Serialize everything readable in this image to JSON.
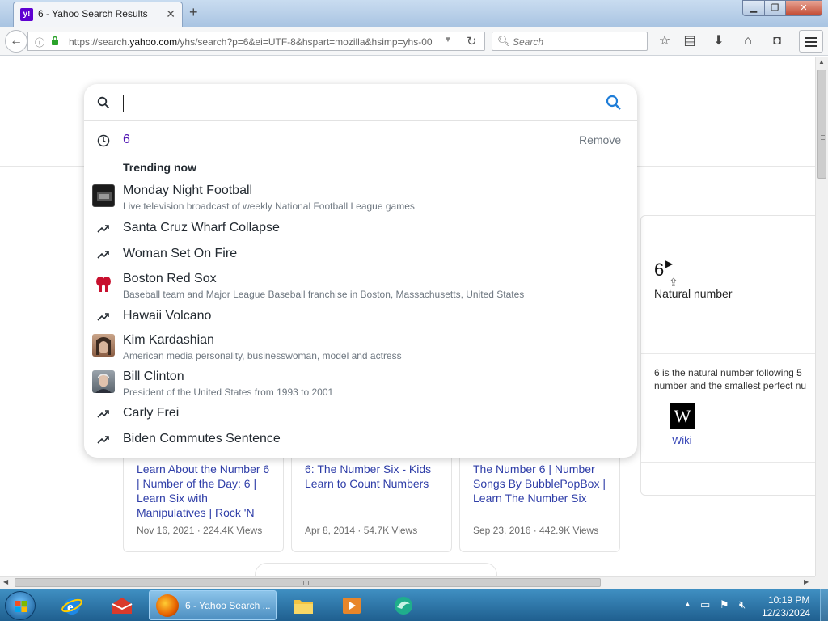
{
  "browser": {
    "tab_title": "6 - Yahoo Search Results",
    "tab_favicon": "y!",
    "url_prefix": "https://search.",
    "url_domain": "yahoo.com",
    "url_rest": "/yhs/search?p=6&ei=UTF-8&hspart=mozilla&hsimp=yhs-00",
    "search_placeholder": "Search",
    "icons": [
      "back-icon",
      "info-icon",
      "lock-icon",
      "reload-icon",
      "search-icon",
      "bookmark-star-icon",
      "reading-list-icon",
      "download-icon",
      "home-icon",
      "pocket-icon",
      "hamburger-menu-icon"
    ]
  },
  "search_dropdown": {
    "history": {
      "query": "6",
      "remove_label": "Remove"
    },
    "trending_header": "Trending now",
    "items": [
      {
        "title": "Monday Night Football",
        "subtitle": "Live television broadcast of weekly National Football League games",
        "kind": "thumb"
      },
      {
        "title": "Santa Cruz Wharf Collapse",
        "subtitle": "",
        "kind": "trend"
      },
      {
        "title": "Woman Set On Fire",
        "subtitle": "",
        "kind": "trend"
      },
      {
        "title": "Boston Red Sox",
        "subtitle": "Baseball team and Major League Baseball franchise in Boston, Massachusetts, United States",
        "kind": "thumb"
      },
      {
        "title": "Hawaii Volcano",
        "subtitle": "",
        "kind": "trend"
      },
      {
        "title": "Kim Kardashian",
        "subtitle": "American media personality, businesswoman, model and actress",
        "kind": "thumb"
      },
      {
        "title": "Bill Clinton",
        "subtitle": "President of the United States from 1993 to 2001",
        "kind": "thumb"
      },
      {
        "title": "Carly Frei",
        "subtitle": "",
        "kind": "trend"
      },
      {
        "title": "Biden Commutes Sentence",
        "subtitle": "",
        "kind": "trend"
      }
    ]
  },
  "knowledge_panel": {
    "number": "6",
    "subtitle": "Natural number",
    "description_line1": "6 is the natural number following 5",
    "description_line2": "number and the smallest perfect nu",
    "wiki_logo": "W",
    "wiki_label": "Wiki"
  },
  "videos": [
    {
      "title": "Learn About the Number 6 | Number of the Day: 6 | Learn Six with Manipulatives | Rock 'N",
      "meta": "Nov 16, 2021 · 224.4K Views"
    },
    {
      "title": "6: The Number Six - Kids Learn to Count Numbers",
      "meta": "Apr 8, 2014 · 54.7K Views"
    },
    {
      "title": "The Number 6 | Number Songs By BubblePopBox | Learn The Number Six",
      "meta": "Sep 23, 2016 · 442.9K Views"
    }
  ],
  "taskbar": {
    "active_task_label": "6 - Yahoo Search ...",
    "clock_time": "10:19 PM",
    "clock_date": "12/23/2024"
  },
  "colors": {
    "yahoo_purple": "#5f01d1",
    "link_blue": "#2f3ea8",
    "history_purple": "#5015b3",
    "search_blue": "#1e7dd8"
  }
}
